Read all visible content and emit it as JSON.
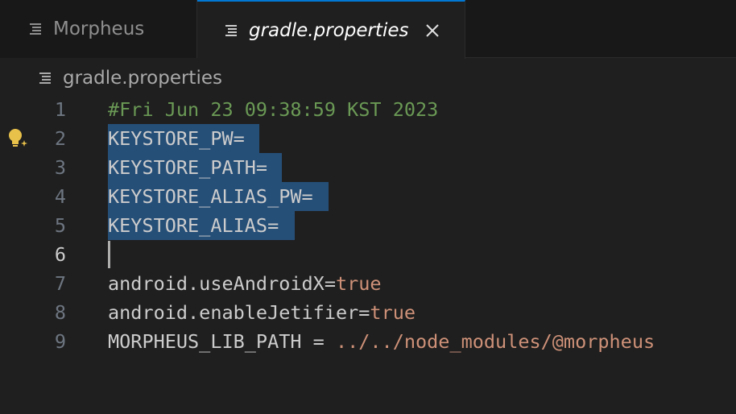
{
  "tabs": [
    {
      "label": "Morpheus",
      "active": false
    },
    {
      "label": "gradle.properties",
      "active": true
    }
  ],
  "breadcrumb": {
    "file": "gradle.properties"
  },
  "colors": {
    "accent": "#0078d4",
    "selection": "#264f78",
    "comment": "#6a9955",
    "value": "#ce9178",
    "lightbulb": "#e8c14a"
  },
  "lines": [
    {
      "num": "1",
      "text": "#Fri Jun 23 09:38:59 KST 2023"
    },
    {
      "num": "2",
      "text": "KEYSTORE_PW="
    },
    {
      "num": "3",
      "text": "KEYSTORE_PATH="
    },
    {
      "num": "4",
      "text": "KEYSTORE_ALIAS_PW="
    },
    {
      "num": "5",
      "text": "KEYSTORE_ALIAS="
    },
    {
      "num": "6",
      "text": ""
    },
    {
      "num": "7",
      "key": "android.useAndroidX=",
      "value": "true"
    },
    {
      "num": "8",
      "key": "android.enableJetifier=",
      "value": "true"
    },
    {
      "num": "9",
      "key": "MORPHEUS_LIB_PATH = ",
      "value": "../../node_modules/@morpheus"
    }
  ],
  "icons": {
    "tab_file": "file-lines-icon",
    "close": "close-icon",
    "lightbulb": "lightbulb-sparkle-icon"
  }
}
